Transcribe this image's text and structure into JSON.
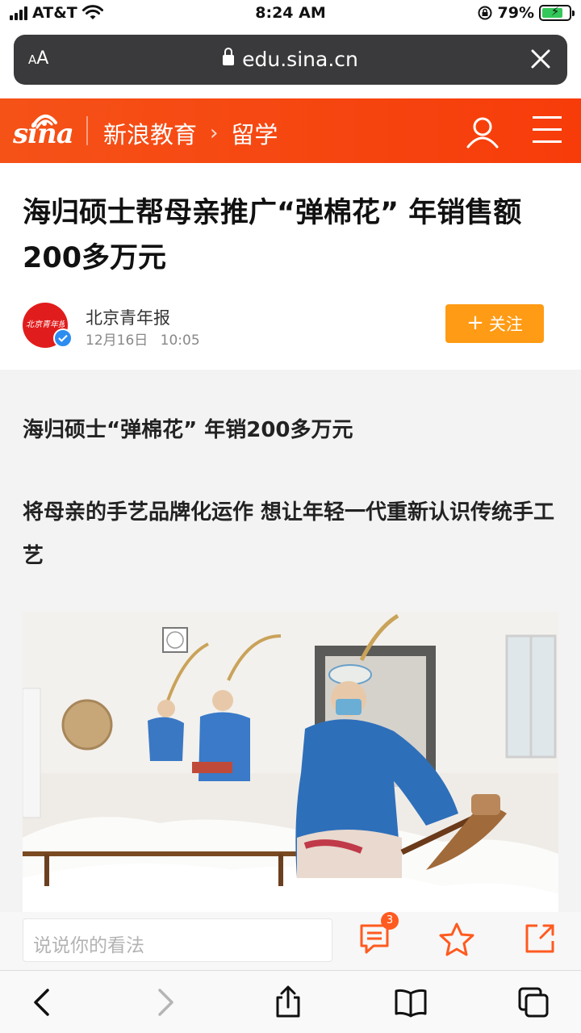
{
  "status_bar": {
    "carrier": "AT&T",
    "time": "8:24 AM",
    "battery_percent": "79%",
    "battery_level": 0.79,
    "icons": [
      "signal-icon",
      "wifi-icon",
      "rotation-lock-icon",
      "battery-charging-icon"
    ]
  },
  "browser": {
    "text_size_label": "AA",
    "url": "edu.sina.cn"
  },
  "site_header": {
    "logo_text": "sina",
    "breadcrumb": [
      "新浪教育",
      "留学"
    ],
    "colors": {
      "header_start": "#f55218",
      "header_end": "#f73c0a"
    }
  },
  "article": {
    "title": "海归硕士帮母亲推广“弹棉花” 年销售额200多万元",
    "author": "北京青年报",
    "avatar_text": "北京青年报",
    "date": "12月16日",
    "time": "10:05",
    "follow_label": "关注",
    "paragraph_1": "海归硕士“弹棉花” 年销200多万元",
    "paragraph_2": "将母亲的手艺品牌化运作 想让年轻一代重新认识传统手工艺",
    "colors": {
      "follow_button": "#ff9b14"
    }
  },
  "comment_bar": {
    "placeholder": "说说你的看法",
    "comment_count": "3",
    "colors": {
      "accent": "#ff5a1f"
    }
  },
  "safari_toolbar": {
    "items": [
      "back-icon",
      "forward-icon",
      "share-icon",
      "bookmarks-icon",
      "tabs-icon"
    ]
  }
}
